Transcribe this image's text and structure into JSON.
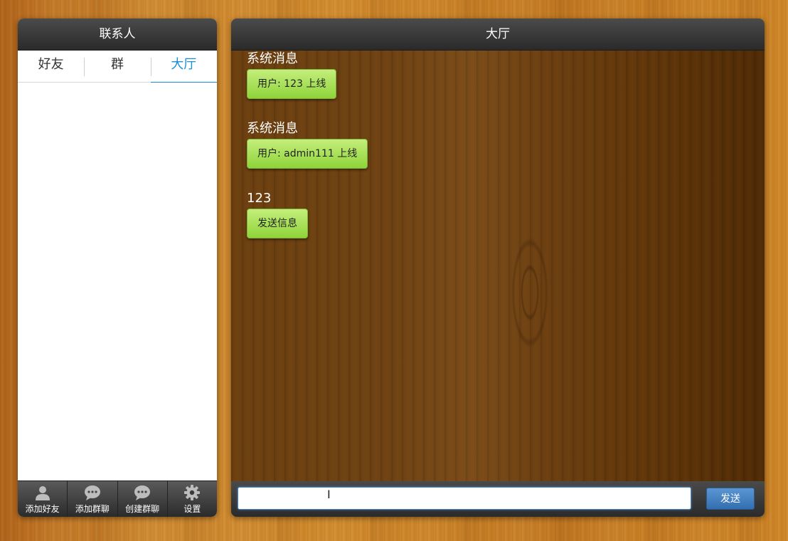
{
  "contacts": {
    "title": "联系人",
    "tabs": [
      {
        "label": "好友",
        "active": false
      },
      {
        "label": "群",
        "active": false
      },
      {
        "label": "大厅",
        "active": true
      }
    ],
    "toolbar": [
      {
        "label": "添加好友",
        "icon": "person-icon"
      },
      {
        "label": "添加群聊",
        "icon": "chat-bubble-icon"
      },
      {
        "label": "创建群聊",
        "icon": "chat-bubble-icon"
      },
      {
        "label": "设置",
        "icon": "gear-icon"
      }
    ]
  },
  "lobby": {
    "title": "大厅",
    "messages": [
      {
        "sender": "系统消息",
        "text": "用户: 123 上线"
      },
      {
        "sender": "系统消息",
        "text": "用户: admin111 上线"
      },
      {
        "sender": "123",
        "text": "发送信息"
      }
    ],
    "input": {
      "value": "",
      "placeholder": ""
    },
    "send_label": "发送"
  },
  "colors": {
    "accent": "#1a8fd6",
    "bubble": "#a8e05a",
    "send_button": "#4a86c8",
    "header": "#333333"
  }
}
